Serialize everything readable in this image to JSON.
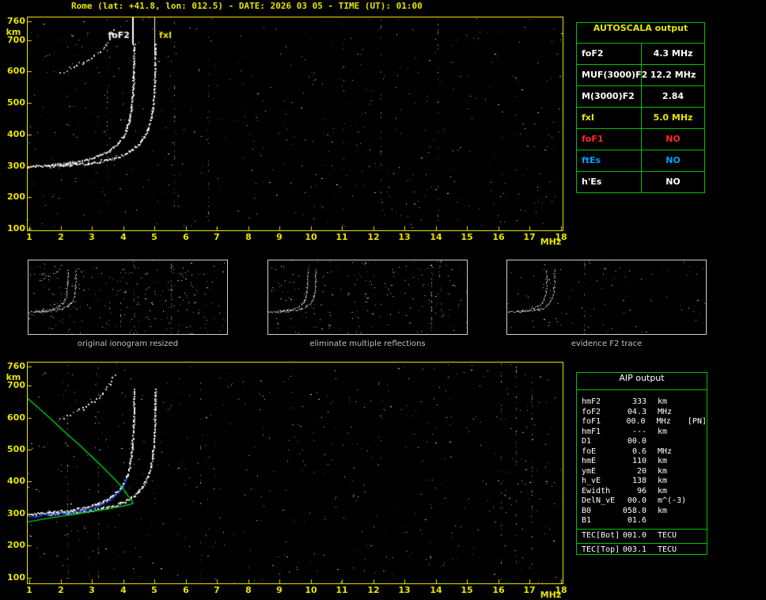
{
  "title": "Rome (lat: +41.8, lon: 012.5) - DATE: 2026 03 05 - TIME (UT): 01:00",
  "colors": {
    "axis_yellow": "#e8e400",
    "table_green": "#00c000",
    "white": "#ffffff",
    "red": "#ff2828",
    "blue": "#00a0ff",
    "profile_green": "#00cc22",
    "trace_blue": "#2a50ff",
    "caption_gray": "#c0c0c0"
  },
  "axes": {
    "y_unit": "km",
    "x_unit": "MHz",
    "y_ticks": [
      760,
      700,
      600,
      500,
      400,
      300,
      200,
      100
    ],
    "x_ticks": [
      1,
      2,
      3,
      4,
      5,
      6,
      7,
      8,
      9,
      10,
      11,
      12,
      13,
      14,
      15,
      16,
      17,
      18
    ]
  },
  "plot_labels": {
    "foF2": "foF2",
    "fxI": "fxI"
  },
  "autoscala": {
    "title": "AUTOSCALA output",
    "rows": [
      {
        "label": "foF2",
        "value": "4.3 MHz",
        "color": "#ffffff"
      },
      {
        "label": "MUF(3000)F2",
        "value": "12.2 MHz",
        "color": "#ffffff"
      },
      {
        "label": "M(3000)F2",
        "value": "2.84",
        "color": "#ffffff"
      },
      {
        "label": "fxI",
        "value": "5.0 MHz",
        "color": "#e8e400"
      },
      {
        "label": "foF1",
        "value": "NO",
        "color": "#ff2828"
      },
      {
        "label": "ftEs",
        "value": "NO",
        "color": "#00a0ff"
      },
      {
        "label": "h'Es",
        "value": "NO",
        "color": "#ffffff"
      }
    ]
  },
  "thumbnails": [
    {
      "caption": "original ionogram resized"
    },
    {
      "caption": "eliminate multiple reflections"
    },
    {
      "caption": "evidence F2 trace"
    }
  ],
  "aip": {
    "title": "AIP output",
    "rows": [
      {
        "label": "hmF2",
        "value": "333",
        "unit": "km",
        "extra": ""
      },
      {
        "label": "foF2",
        "value": "04.3",
        "unit": "MHz",
        "extra": ""
      },
      {
        "label": "foF1",
        "value": "00.0",
        "unit": "MHz",
        "extra": "[PN]"
      },
      {
        "label": "hmF1",
        "value": "---",
        "unit": "km",
        "extra": ""
      },
      {
        "label": "D1",
        "value": "00.0",
        "unit": "",
        "extra": ""
      },
      {
        "label": "foE",
        "value": "0.6",
        "unit": "MHz",
        "extra": ""
      },
      {
        "label": "hmE",
        "value": "110",
        "unit": "km",
        "extra": ""
      },
      {
        "label": "ymE",
        "value": "20",
        "unit": "km",
        "extra": ""
      },
      {
        "label": "h_vE",
        "value": "138",
        "unit": "km",
        "extra": ""
      },
      {
        "label": "Ewidth",
        "value": "96",
        "unit": "km",
        "extra": ""
      },
      {
        "label": "DelN_vE",
        "value": "00.0",
        "unit": "m^(-3)",
        "extra": ""
      },
      {
        "label": "B0",
        "value": "058.0",
        "unit": "km",
        "extra": ""
      },
      {
        "label": "B1",
        "value": "01.6",
        "unit": "",
        "extra": ""
      }
    ],
    "tec_rows": [
      {
        "label": "TEC[Bot]",
        "value": "001.0",
        "unit": "TECU",
        "extra": ""
      },
      {
        "label": "TEC[Top]",
        "value": "003.1",
        "unit": "TECU",
        "extra": ""
      }
    ]
  },
  "chart_data": {
    "type": "scatter",
    "title": "Rome (lat: +41.8, lon: 012.5) - DATE: 2026 03 05 - TIME (UT): 01:00",
    "xlabel": "MHz",
    "ylabel": "km",
    "xlim": [
      1,
      18
    ],
    "ylim": [
      100,
      760
    ],
    "foF2_MHz": 4.3,
    "fxI_MHz": 5.0,
    "hmF2_km": 333,
    "traces": {
      "o_mode_virtual_height": [
        [
          0.95,
          299
        ],
        [
          1.6,
          304
        ],
        [
          2.2,
          310
        ],
        [
          2.8,
          320
        ],
        [
          3.2,
          332
        ],
        [
          3.55,
          350
        ],
        [
          3.8,
          370
        ],
        [
          3.98,
          393
        ],
        [
          4.1,
          418
        ],
        [
          4.19,
          448
        ],
        [
          4.25,
          482
        ],
        [
          4.29,
          525
        ],
        [
          4.315,
          575
        ],
        [
          4.33,
          630
        ],
        [
          4.34,
          688
        ]
      ],
      "x_mode_offset_MHz": 0.68,
      "second_hop": [
        [
          1.95,
          595
        ],
        [
          2.3,
          612
        ],
        [
          2.7,
          630
        ],
        [
          3.05,
          652
        ],
        [
          3.35,
          678
        ],
        [
          3.55,
          706
        ],
        [
          3.7,
          735
        ]
      ],
      "electron_density_profile": [
        [
          0.95,
          660
        ],
        [
          1.3,
          630
        ],
        [
          1.7,
          595
        ],
        [
          2.1,
          558
        ],
        [
          2.6,
          515
        ],
        [
          3.0,
          478
        ],
        [
          3.4,
          440
        ],
        [
          3.75,
          406
        ],
        [
          4.0,
          378
        ],
        [
          4.18,
          352
        ],
        [
          4.28,
          340
        ],
        [
          4.32,
          333
        ],
        [
          4.2,
          328
        ],
        [
          3.9,
          322
        ],
        [
          3.4,
          313
        ],
        [
          2.9,
          305
        ],
        [
          2.4,
          297
        ],
        [
          1.9,
          290
        ],
        [
          1.4,
          282
        ],
        [
          0.95,
          274
        ]
      ]
    }
  }
}
